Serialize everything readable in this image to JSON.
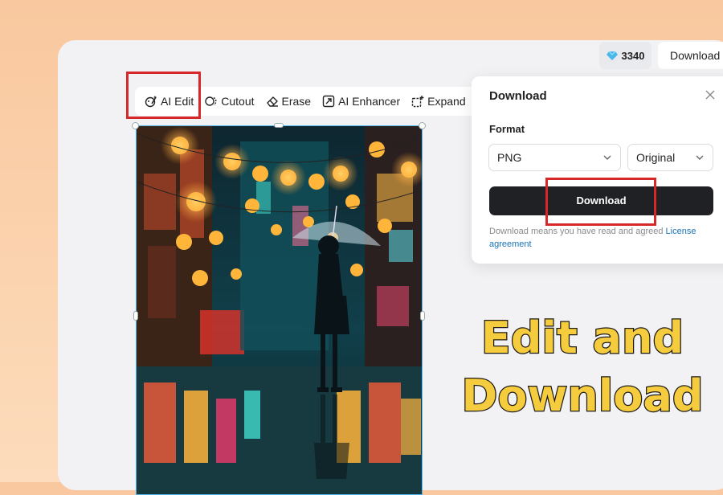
{
  "header": {
    "credits_count": "3340",
    "download_label": "Download"
  },
  "toolbar": {
    "tools": [
      {
        "label": "AI Edit",
        "icon": "palette-sparkle-icon"
      },
      {
        "label": "Cutout",
        "icon": "cutout-icon"
      },
      {
        "label": "Erase",
        "icon": "eraser-icon"
      },
      {
        "label": "AI Enhancer",
        "icon": "enhance-icon"
      },
      {
        "label": "Expand",
        "icon": "expand-icon"
      }
    ]
  },
  "download_panel": {
    "title": "Download",
    "format_label": "Format",
    "format_value": "PNG",
    "size_value": "Original",
    "button_label": "Download",
    "disclaimer_text": "Download means you have read and agreed",
    "disclaimer_link": "License agreement"
  },
  "caption": {
    "line1": "Edit and",
    "line2": "Download"
  },
  "colors": {
    "highlight": "#d62828",
    "caption_fill": "#f6cc3f",
    "button_bg": "#202124",
    "selection": "#4fb5ea"
  }
}
